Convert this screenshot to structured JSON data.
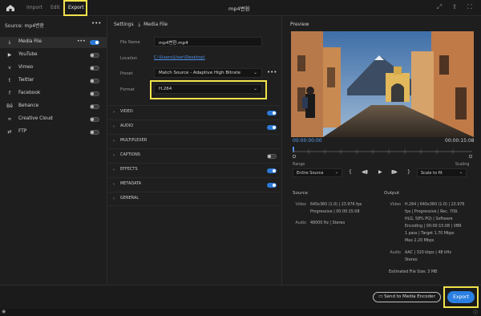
{
  "topbar": {
    "tabs": [
      {
        "label": "Import"
      },
      {
        "label": "Edit"
      },
      {
        "label": "Export"
      }
    ],
    "title": "mp4변환"
  },
  "left": {
    "source_label": "Source:  mp4변환",
    "more": "•••",
    "destinations": [
      {
        "label": "Media File",
        "icon": "download-icon",
        "on": true
      },
      {
        "label": "YouTube",
        "icon": "youtube-icon",
        "on": false
      },
      {
        "label": "Vimeo",
        "icon": "vimeo-icon",
        "on": false
      },
      {
        "label": "Twitter",
        "icon": "twitter-icon",
        "on": false
      },
      {
        "label": "Facebook",
        "icon": "facebook-icon",
        "on": false
      },
      {
        "label": "Behance",
        "icon": "behance-icon",
        "on": false
      },
      {
        "label": "Creative Cloud",
        "icon": "creative-cloud-icon",
        "on": false
      },
      {
        "label": "FTP",
        "icon": "ftp-icon",
        "on": false
      }
    ],
    "media_file_dots": "•••"
  },
  "settings": {
    "header": "Settings",
    "header_sub": "Media File",
    "file_name_label": "File Name",
    "file_name_value": "mp4변환.mp4",
    "location_label": "Location",
    "location_value": "C:\\Users\\User\\Desktop\\",
    "preset_label": "Preset",
    "preset_value": "Match Source - Adaptive High Bitrate",
    "format_label": "Format",
    "format_value": "H.264",
    "sections": [
      {
        "name": "VIDEO",
        "toggle": true
      },
      {
        "name": "AUDIO",
        "toggle": true
      },
      {
        "name": "MULTIPLEXER",
        "toggle": null
      },
      {
        "name": "CAPTIONS",
        "toggle": false
      },
      {
        "name": "EFFECTS",
        "toggle": true
      },
      {
        "name": "METADATA",
        "toggle": true
      },
      {
        "name": "GENERAL",
        "toggle": null
      }
    ]
  },
  "preview": {
    "header": "Preview",
    "tc_start": "00:00:00:00",
    "tc_end": "00:00:15:08",
    "range_label": "Range",
    "range_value": "Entire Source",
    "scaling_label": "Scaling",
    "scaling_value": "Scale to fit"
  },
  "source_info": {
    "title": "Source",
    "video_key": "Video",
    "video_lines": [
      "640x360 (1.0)  |  23.976 fps",
      "Progressive  |  00:00:15:08"
    ],
    "audio_key": "Audio",
    "audio_lines": [
      "48000 Hz  |  Stereo"
    ]
  },
  "output_info": {
    "title": "Output",
    "video_key": "Video",
    "video_lines": [
      "H.264  |  640x360 (1.0)  |  23.976",
      "fps  |  Progressive  |  Rec. 709,",
      "HLG, 58% PQ)  |  Software",
      "Encoding  |  00:00:15:08  |  VBR",
      "1 pass  |  Target 1.70 Mbps",
      "Max 2.20 Mbps"
    ],
    "audio_key": "Audio",
    "audio_lines": [
      "AAC  |  320 kbps  |  48 kHz",
      "Stereo"
    ],
    "size_label": "Estimated File Size:  3 MB"
  },
  "bottom": {
    "ame_label": "Send to Media Encoder",
    "export_label": "Export"
  },
  "colors": {
    "accent": "#2a7fe0",
    "highlight": "#f1e24c"
  }
}
